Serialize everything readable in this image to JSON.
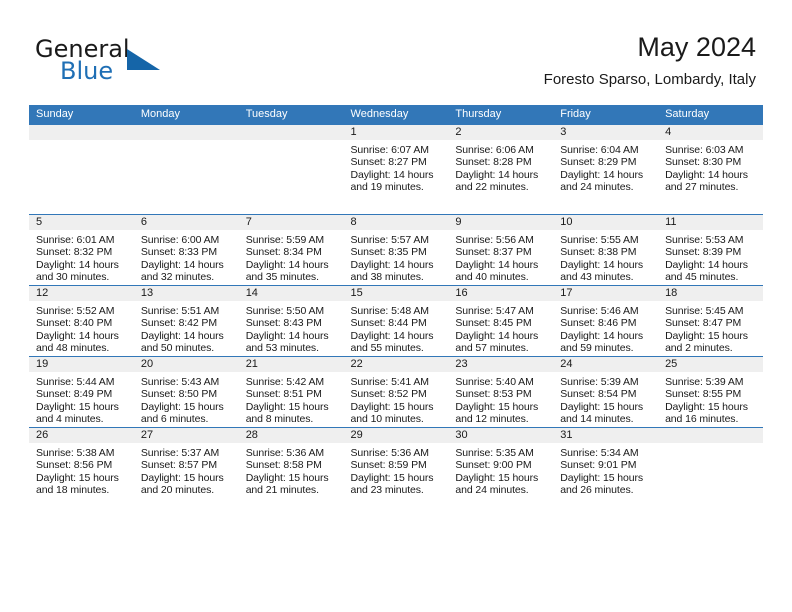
{
  "brand": {
    "word_one": "General",
    "word_two": "Blue",
    "triangle_icon": "triangle-logo-icon",
    "accent_color": "#1565a8"
  },
  "header": {
    "month_title": "May 2024",
    "location": "Foresto Sparso, Lombardy, Italy"
  },
  "theme": {
    "header_row_bg": "#3277b8",
    "daynum_band_bg": "#efefef",
    "row_border": "#3277b8",
    "text": "#1a1a1a"
  },
  "calendar": {
    "day_headers": [
      "Sunday",
      "Monday",
      "Tuesday",
      "Wednesday",
      "Thursday",
      "Friday",
      "Saturday"
    ],
    "weeks": [
      [
        {
          "day": "",
          "lines": [
            "",
            "",
            "",
            ""
          ]
        },
        {
          "day": "",
          "lines": [
            "",
            "",
            "",
            ""
          ]
        },
        {
          "day": "",
          "lines": [
            "",
            "",
            "",
            ""
          ]
        },
        {
          "day": "1",
          "lines": [
            "Sunrise: 6:07 AM",
            "Sunset: 8:27 PM",
            "Daylight: 14 hours",
            "and 19 minutes."
          ]
        },
        {
          "day": "2",
          "lines": [
            "Sunrise: 6:06 AM",
            "Sunset: 8:28 PM",
            "Daylight: 14 hours",
            "and 22 minutes."
          ]
        },
        {
          "day": "3",
          "lines": [
            "Sunrise: 6:04 AM",
            "Sunset: 8:29 PM",
            "Daylight: 14 hours",
            "and 24 minutes."
          ]
        },
        {
          "day": "4",
          "lines": [
            "Sunrise: 6:03 AM",
            "Sunset: 8:30 PM",
            "Daylight: 14 hours",
            "and 27 minutes."
          ]
        }
      ],
      [
        {
          "day": "5",
          "lines": [
            "Sunrise: 6:01 AM",
            "Sunset: 8:32 PM",
            "Daylight: 14 hours",
            "and 30 minutes."
          ]
        },
        {
          "day": "6",
          "lines": [
            "Sunrise: 6:00 AM",
            "Sunset: 8:33 PM",
            "Daylight: 14 hours",
            "and 32 minutes."
          ]
        },
        {
          "day": "7",
          "lines": [
            "Sunrise: 5:59 AM",
            "Sunset: 8:34 PM",
            "Daylight: 14 hours",
            "and 35 minutes."
          ]
        },
        {
          "day": "8",
          "lines": [
            "Sunrise: 5:57 AM",
            "Sunset: 8:35 PM",
            "Daylight: 14 hours",
            "and 38 minutes."
          ]
        },
        {
          "day": "9",
          "lines": [
            "Sunrise: 5:56 AM",
            "Sunset: 8:37 PM",
            "Daylight: 14 hours",
            "and 40 minutes."
          ]
        },
        {
          "day": "10",
          "lines": [
            "Sunrise: 5:55 AM",
            "Sunset: 8:38 PM",
            "Daylight: 14 hours",
            "and 43 minutes."
          ]
        },
        {
          "day": "11",
          "lines": [
            "Sunrise: 5:53 AM",
            "Sunset: 8:39 PM",
            "Daylight: 14 hours",
            "and 45 minutes."
          ]
        }
      ],
      [
        {
          "day": "12",
          "lines": [
            "Sunrise: 5:52 AM",
            "Sunset: 8:40 PM",
            "Daylight: 14 hours",
            "and 48 minutes."
          ]
        },
        {
          "day": "13",
          "lines": [
            "Sunrise: 5:51 AM",
            "Sunset: 8:42 PM",
            "Daylight: 14 hours",
            "and 50 minutes."
          ]
        },
        {
          "day": "14",
          "lines": [
            "Sunrise: 5:50 AM",
            "Sunset: 8:43 PM",
            "Daylight: 14 hours",
            "and 53 minutes."
          ]
        },
        {
          "day": "15",
          "lines": [
            "Sunrise: 5:48 AM",
            "Sunset: 8:44 PM",
            "Daylight: 14 hours",
            "and 55 minutes."
          ]
        },
        {
          "day": "16",
          "lines": [
            "Sunrise: 5:47 AM",
            "Sunset: 8:45 PM",
            "Daylight: 14 hours",
            "and 57 minutes."
          ]
        },
        {
          "day": "17",
          "lines": [
            "Sunrise: 5:46 AM",
            "Sunset: 8:46 PM",
            "Daylight: 14 hours",
            "and 59 minutes."
          ]
        },
        {
          "day": "18",
          "lines": [
            "Sunrise: 5:45 AM",
            "Sunset: 8:47 PM",
            "Daylight: 15 hours",
            "and 2 minutes."
          ]
        }
      ],
      [
        {
          "day": "19",
          "lines": [
            "Sunrise: 5:44 AM",
            "Sunset: 8:49 PM",
            "Daylight: 15 hours",
            "and 4 minutes."
          ]
        },
        {
          "day": "20",
          "lines": [
            "Sunrise: 5:43 AM",
            "Sunset: 8:50 PM",
            "Daylight: 15 hours",
            "and 6 minutes."
          ]
        },
        {
          "day": "21",
          "lines": [
            "Sunrise: 5:42 AM",
            "Sunset: 8:51 PM",
            "Daylight: 15 hours",
            "and 8 minutes."
          ]
        },
        {
          "day": "22",
          "lines": [
            "Sunrise: 5:41 AM",
            "Sunset: 8:52 PM",
            "Daylight: 15 hours",
            "and 10 minutes."
          ]
        },
        {
          "day": "23",
          "lines": [
            "Sunrise: 5:40 AM",
            "Sunset: 8:53 PM",
            "Daylight: 15 hours",
            "and 12 minutes."
          ]
        },
        {
          "day": "24",
          "lines": [
            "Sunrise: 5:39 AM",
            "Sunset: 8:54 PM",
            "Daylight: 15 hours",
            "and 14 minutes."
          ]
        },
        {
          "day": "25",
          "lines": [
            "Sunrise: 5:39 AM",
            "Sunset: 8:55 PM",
            "Daylight: 15 hours",
            "and 16 minutes."
          ]
        }
      ],
      [
        {
          "day": "26",
          "lines": [
            "Sunrise: 5:38 AM",
            "Sunset: 8:56 PM",
            "Daylight: 15 hours",
            "and 18 minutes."
          ]
        },
        {
          "day": "27",
          "lines": [
            "Sunrise: 5:37 AM",
            "Sunset: 8:57 PM",
            "Daylight: 15 hours",
            "and 20 minutes."
          ]
        },
        {
          "day": "28",
          "lines": [
            "Sunrise: 5:36 AM",
            "Sunset: 8:58 PM",
            "Daylight: 15 hours",
            "and 21 minutes."
          ]
        },
        {
          "day": "29",
          "lines": [
            "Sunrise: 5:36 AM",
            "Sunset: 8:59 PM",
            "Daylight: 15 hours",
            "and 23 minutes."
          ]
        },
        {
          "day": "30",
          "lines": [
            "Sunrise: 5:35 AM",
            "Sunset: 9:00 PM",
            "Daylight: 15 hours",
            "and 24 minutes."
          ]
        },
        {
          "day": "31",
          "lines": [
            "Sunrise: 5:34 AM",
            "Sunset: 9:01 PM",
            "Daylight: 15 hours",
            "and 26 minutes."
          ]
        },
        {
          "day": "",
          "lines": [
            "",
            "",
            "",
            ""
          ]
        }
      ]
    ]
  }
}
